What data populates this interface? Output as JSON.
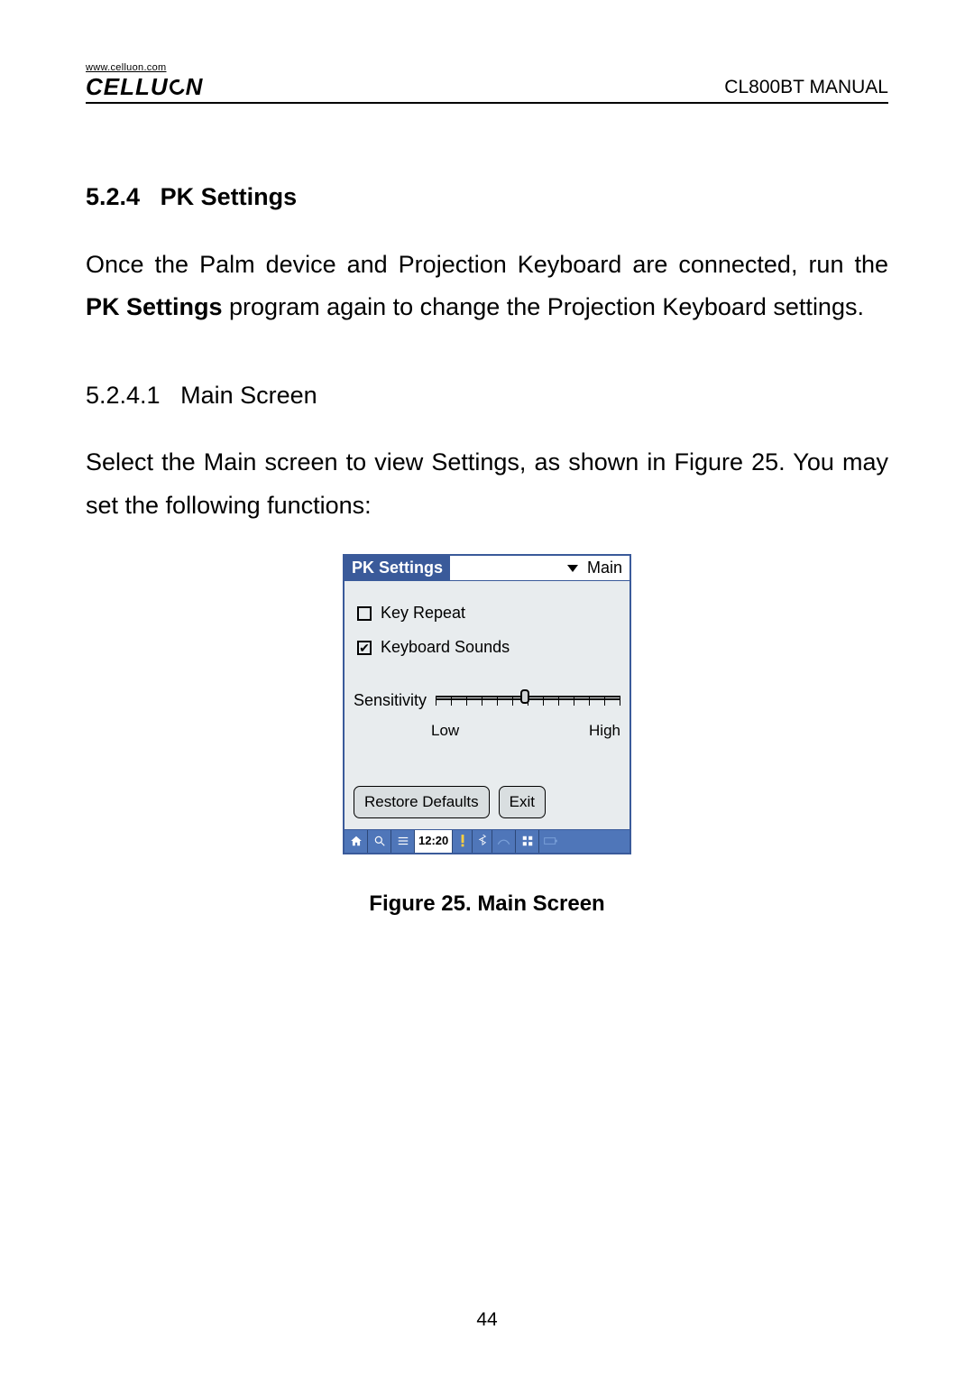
{
  "header": {
    "logo_url": "www.celluon.com",
    "logo_text_prefix": "CELLU",
    "logo_text_suffix": "N",
    "manual_title": "CL800BT MANUAL"
  },
  "section": {
    "number": "5.2.4",
    "title": "PK Settings",
    "para1_a": "Once the Palm device and Projection Keyboard are connected, run the ",
    "para1_bold": "PK Settings",
    "para1_b": " program again to change the Projection Keyboard settings."
  },
  "subsection": {
    "number": "5.2.4.1",
    "title": "Main Screen",
    "para": "Select the Main screen to view Settings, as shown in Figure 25. You may set the following functions:"
  },
  "screenshot": {
    "app_title": "PK Settings",
    "dropdown_label": "Main",
    "check_key_repeat": "Key Repeat",
    "check_keyboard_sounds": "Keyboard Sounds",
    "slider_label": "Sensitivity",
    "slider_low": "Low",
    "slider_high": "High",
    "btn_restore": "Restore Defaults",
    "btn_exit": "Exit",
    "status_time": "12:20"
  },
  "figure_caption": "Figure 25. Main Screen",
  "page_number": "44"
}
